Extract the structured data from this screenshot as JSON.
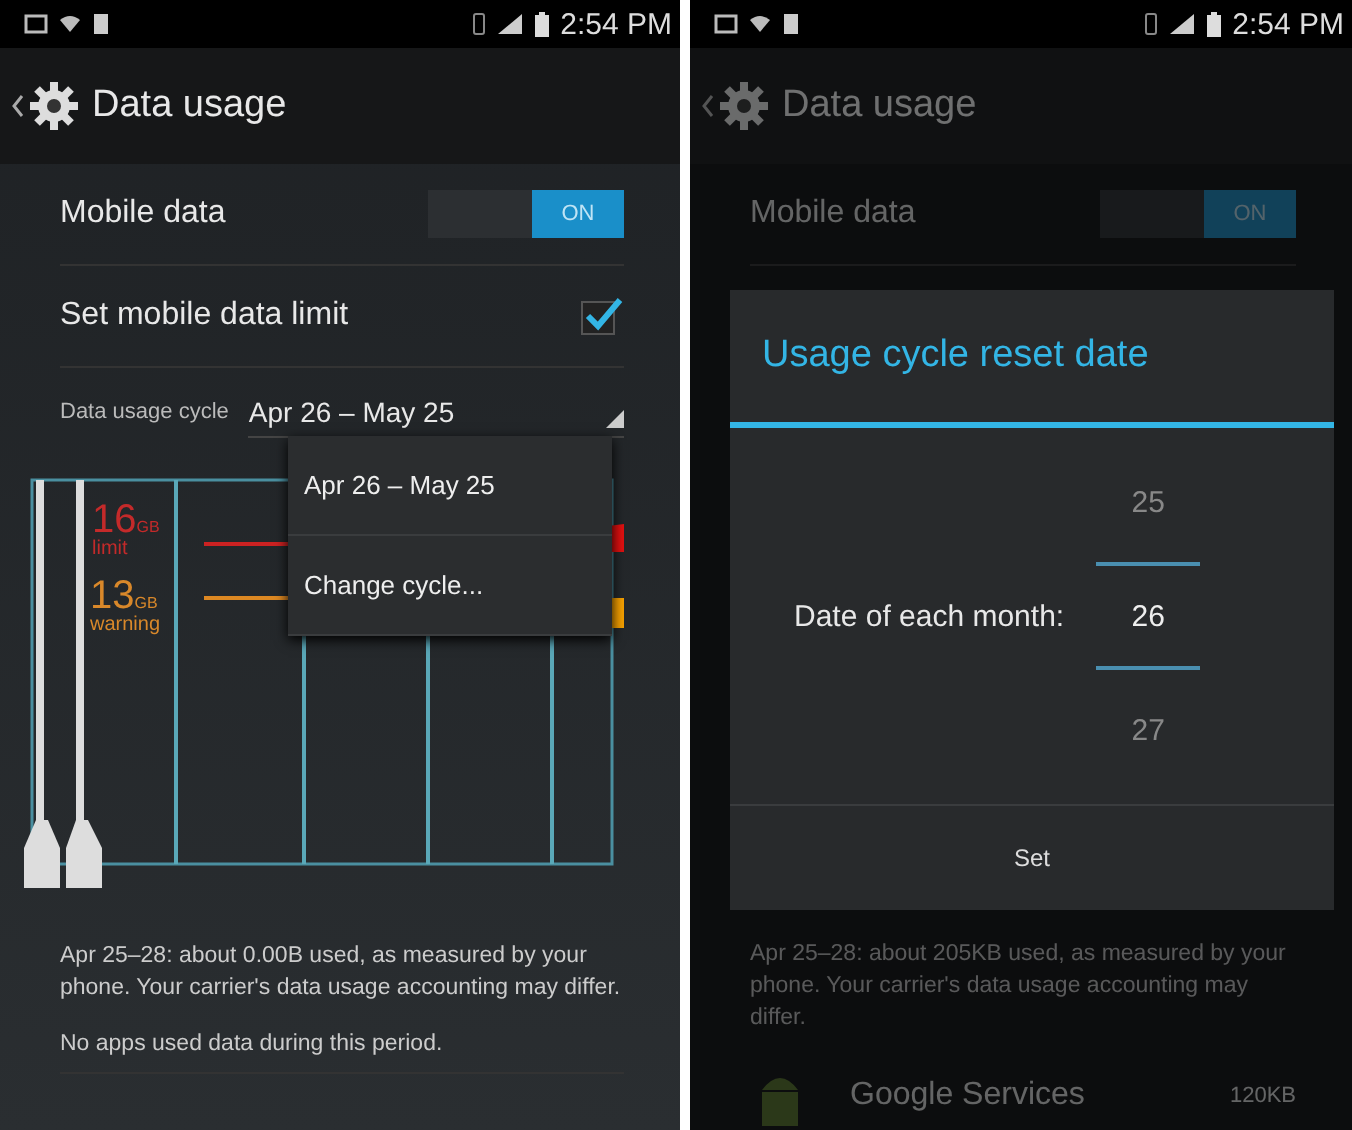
{
  "left_screen": {
    "status_bar": {
      "time": "2:54 PM"
    },
    "action_bar": {
      "title": "Data usage"
    },
    "settings": [
      {
        "kind": "switch",
        "label": "Mobile data",
        "on": true,
        "switch_text": "ON"
      },
      {
        "kind": "checkbox",
        "label": "Set mobile data limit",
        "checked": true
      }
    ],
    "cycle": {
      "label": "Data usage cycle",
      "value": "Apr 26 – May 25"
    },
    "chart": {
      "limit": {
        "value": "16",
        "unit": "GB",
        "label": "limit"
      },
      "warning": {
        "value": "13",
        "unit": "GB",
        "label": "warning"
      }
    },
    "menu": {
      "items": [
        {
          "label": "Apr 26 – May 25"
        },
        {
          "label": "Change cycle..."
        }
      ]
    },
    "summary": "Apr 25–28: about 0.00B used, as measured by your phone. Your carrier's data usage accounting may differ.",
    "no_apps": "No apps used data during this period."
  },
  "right_screen": {
    "status_bar": {
      "time": "2:54 PM"
    },
    "action_bar": {
      "title": "Data usage"
    },
    "settings": [
      {
        "kind": "switch",
        "label": "Mobile data",
        "on": true,
        "switch_text": "ON"
      }
    ],
    "dialog": {
      "title": "Usage cycle reset date",
      "label": "Date of each month:",
      "picker": [
        {
          "value": "25",
          "selected": false
        },
        {
          "value": "26",
          "selected": true
        },
        {
          "value": "27",
          "selected": false
        }
      ],
      "button": "Set"
    },
    "summary": "Apr 25–28: about 205KB used, as measured by your phone. Your carrier's data usage accounting may differ.",
    "apps": [
      {
        "name": "Google Services",
        "usage": "120KB"
      }
    ]
  }
}
